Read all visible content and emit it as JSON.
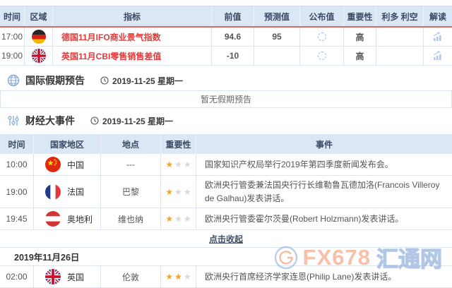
{
  "colors": {
    "accent_red": "#e23b3b",
    "table_header_bg": "#dce7f5",
    "header_underline": "#e06a62",
    "row_border": "#dce6f3",
    "star_gold": "#f8a41d",
    "star_gray": "#d9d9d9",
    "watermark_orange": "rgba(243,140,96,0.55)",
    "watermark_blue": "rgba(138,170,216,0.55)"
  },
  "econ_table": {
    "headers": [
      "时间",
      "区域",
      "指标",
      "前值",
      "预测值",
      "公布值",
      "重要性",
      "利多 利空",
      "解读"
    ],
    "rows": [
      {
        "time": "17:00",
        "country": "germany",
        "flag_icon": "germany-flag-icon",
        "indicator": "德国11月IFO商业景气指数",
        "previous": "94.6",
        "forecast": "95",
        "published": "",
        "published_icon": "loading-spinner-icon",
        "importance": "高",
        "bull_bear": "",
        "interpret_icon": "bar-chart-icon"
      },
      {
        "time": "19:00",
        "country": "uk",
        "flag_icon": "uk-flag-icon",
        "indicator": "英国11月CBI零售销售差值",
        "previous": "-10",
        "forecast": "",
        "published": "",
        "published_icon": "loading-spinner-icon",
        "importance": "高",
        "bull_bear": "",
        "interpret_icon": "bar-chart-icon"
      }
    ]
  },
  "holiday_section": {
    "icon": "globe-icon",
    "title": "国际假期预告",
    "date_icon": "clock-icon",
    "date": "2019-11-25 星期一",
    "empty_text": "暂无假期预告"
  },
  "events_section": {
    "icon": "sliders-icon",
    "title": "财经大事件",
    "date_icon": "clock-icon",
    "date": "2019-11-25 星期一",
    "headers": [
      "时间",
      "国家地区",
      "地点",
      "重要性",
      "事件"
    ],
    "rows": [
      {
        "time": "10:00",
        "country_label": "中国",
        "flag_icon": "china-flag-icon",
        "location": "---",
        "stars": 1,
        "event": "国家知识产权局举行2019年第四季度新闻发布会。"
      },
      {
        "time": "19:00",
        "country_label": "法国",
        "flag_icon": "france-flag-icon",
        "location": "巴黎",
        "stars": 1,
        "event": "欧洲央行管委兼法国央行行长维勒鲁瓦德加洛(Francois Villeroy de Galhau)发表讲话。"
      },
      {
        "time": "19:45",
        "country_label": "奥地利",
        "flag_icon": "austria-flag-icon",
        "location": "维也纳",
        "stars": 1,
        "event": "欧洲央行管委霍尔茨曼(Robert Holzmann)发表讲话。"
      }
    ],
    "collapse_label": "点击收起",
    "next_date": "2019年11月26日",
    "next_rows": [
      {
        "time": "02:00",
        "country_label": "英国",
        "flag_icon": "uk-flag-icon",
        "location": "伦敦",
        "stars": 2,
        "event": "欧洲央行首席经济学家连恩(Philip Lane)发表讲话。"
      }
    ]
  },
  "watermark": {
    "logo_icon": "fx678-swirl-logo-icon",
    "brand": "FX678",
    "site": "汇通网"
  }
}
